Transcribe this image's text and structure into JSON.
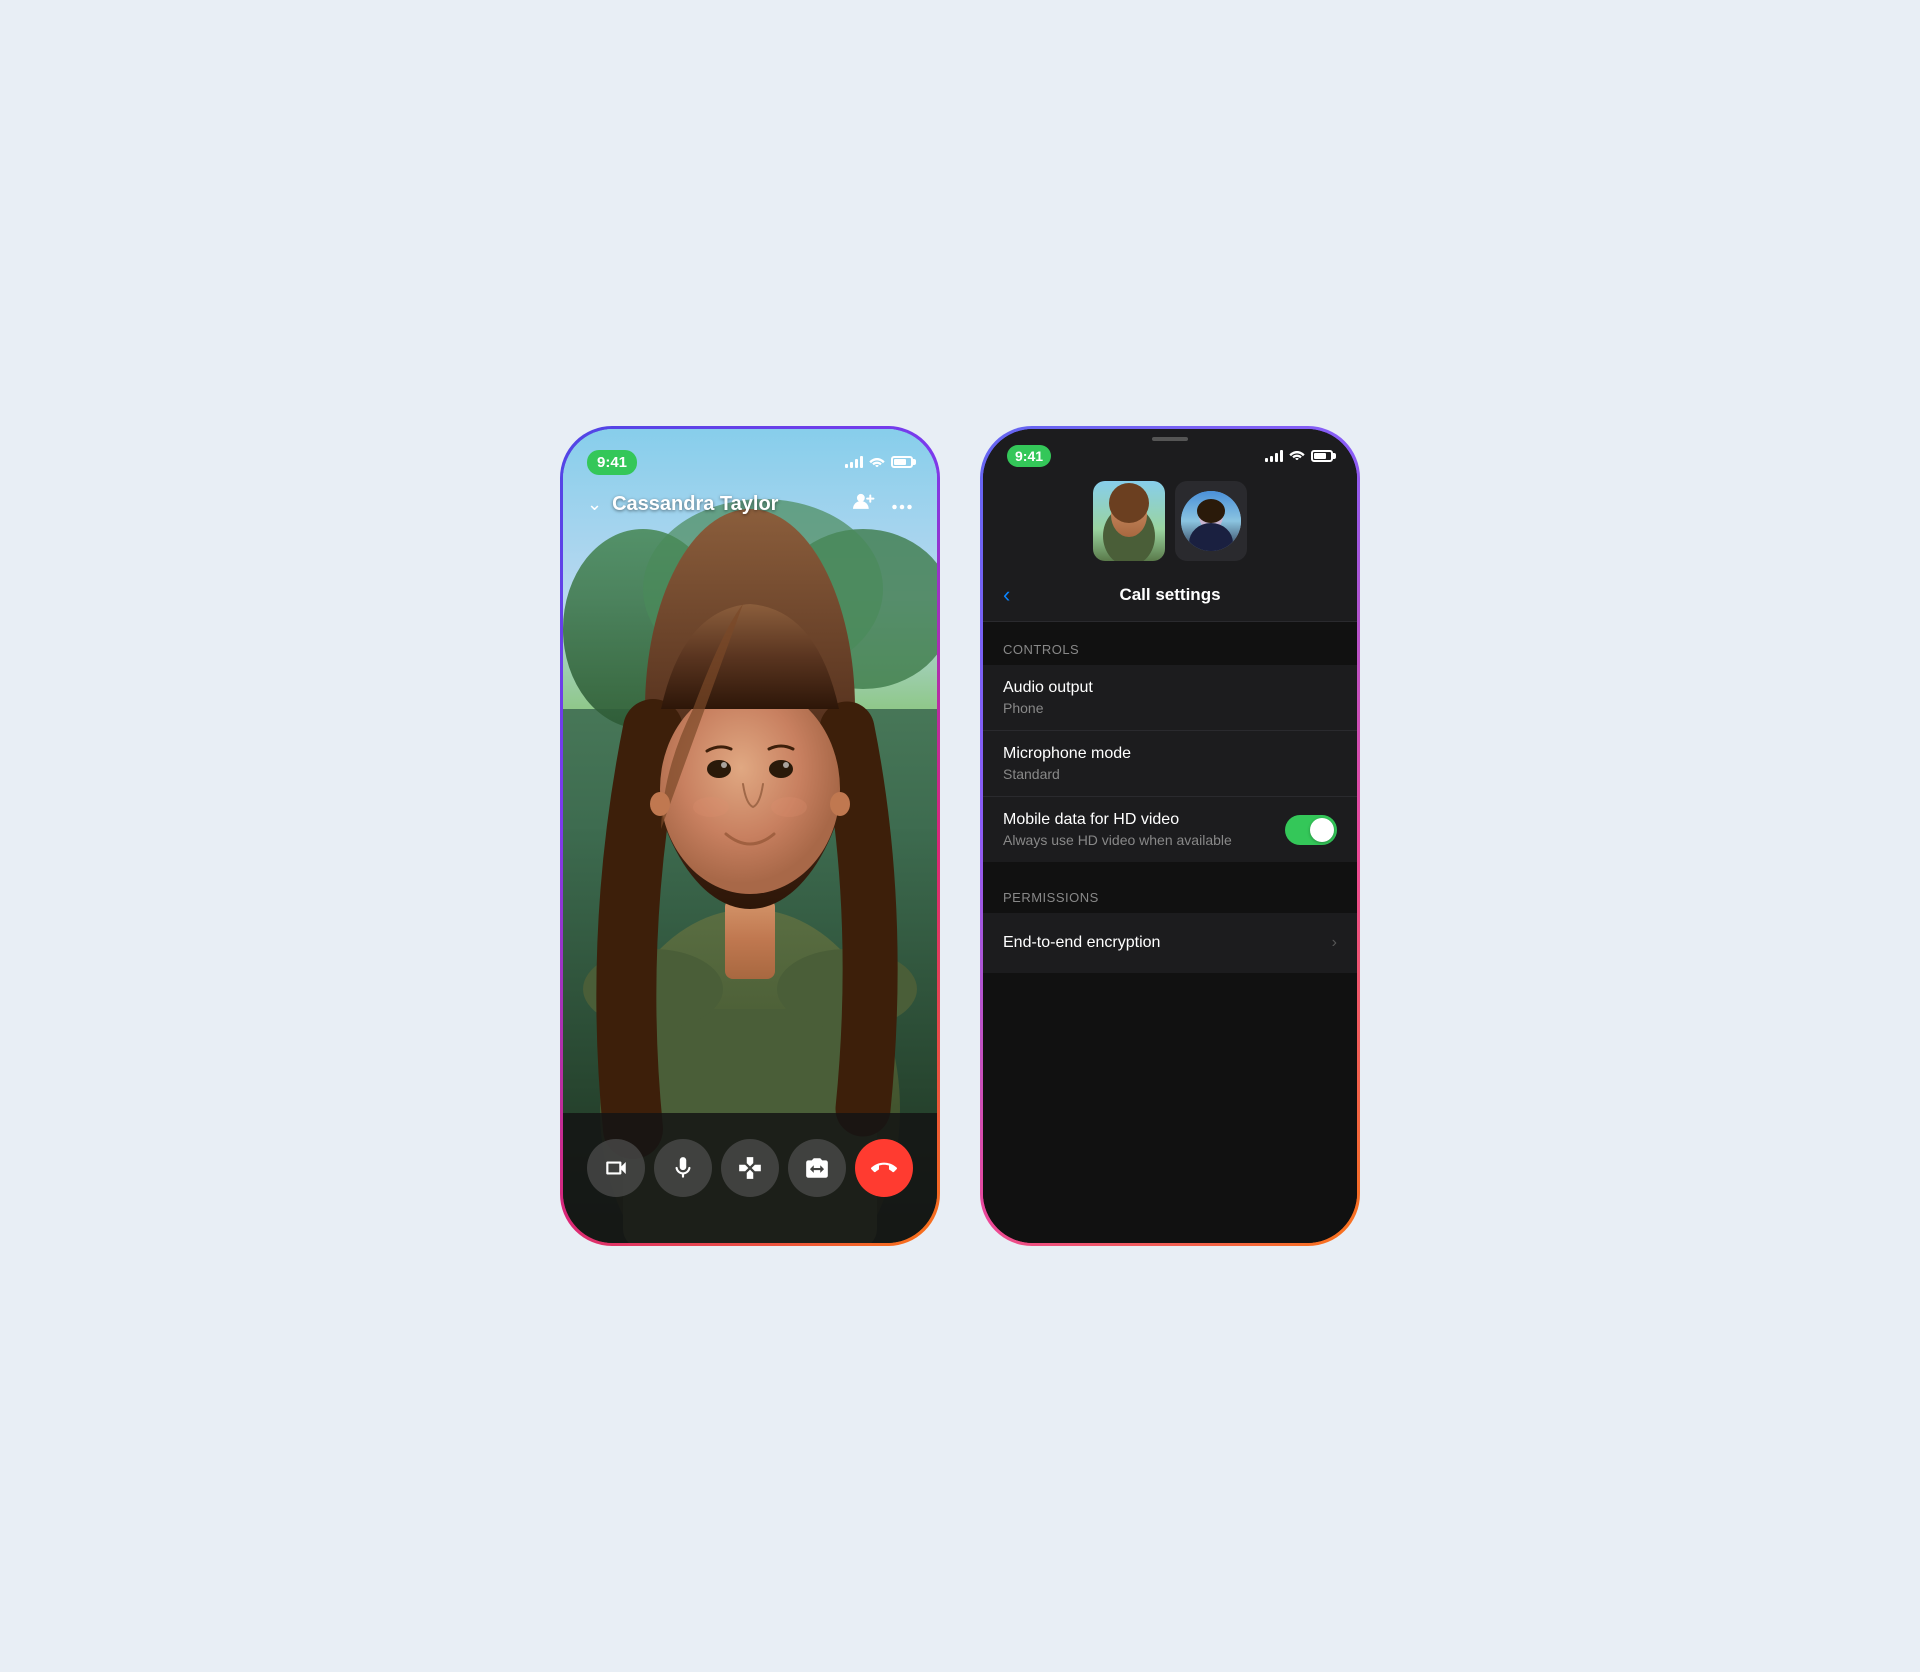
{
  "page": {
    "background": "#e8eef5"
  },
  "left_phone": {
    "status_time": "9:41",
    "caller_name": "Cassandra Taylor",
    "controls": [
      {
        "name": "video",
        "icon": "video-icon"
      },
      {
        "name": "mute",
        "icon": "mic-icon"
      },
      {
        "name": "effects",
        "icon": "effects-icon"
      },
      {
        "name": "camera-flip",
        "icon": "camera-flip-icon"
      },
      {
        "name": "end-call",
        "icon": "end-call-icon"
      }
    ]
  },
  "right_phone": {
    "status_time": "9:41",
    "header": {
      "back_label": "‹",
      "title": "Call settings"
    },
    "sections": [
      {
        "name": "Controls",
        "items": [
          {
            "title": "Audio output",
            "subtitle": "Phone",
            "type": "navigation",
            "has_toggle": false
          },
          {
            "title": "Microphone mode",
            "subtitle": "Standard",
            "type": "navigation",
            "has_toggle": false
          },
          {
            "title": "Mobile data for HD video",
            "subtitle": "Always use HD video when available",
            "type": "toggle",
            "has_toggle": true,
            "toggle_on": true
          }
        ]
      },
      {
        "name": "Permissions",
        "items": [
          {
            "title": "End-to-end encryption",
            "subtitle": "",
            "type": "navigation",
            "has_toggle": false
          }
        ]
      }
    ]
  }
}
